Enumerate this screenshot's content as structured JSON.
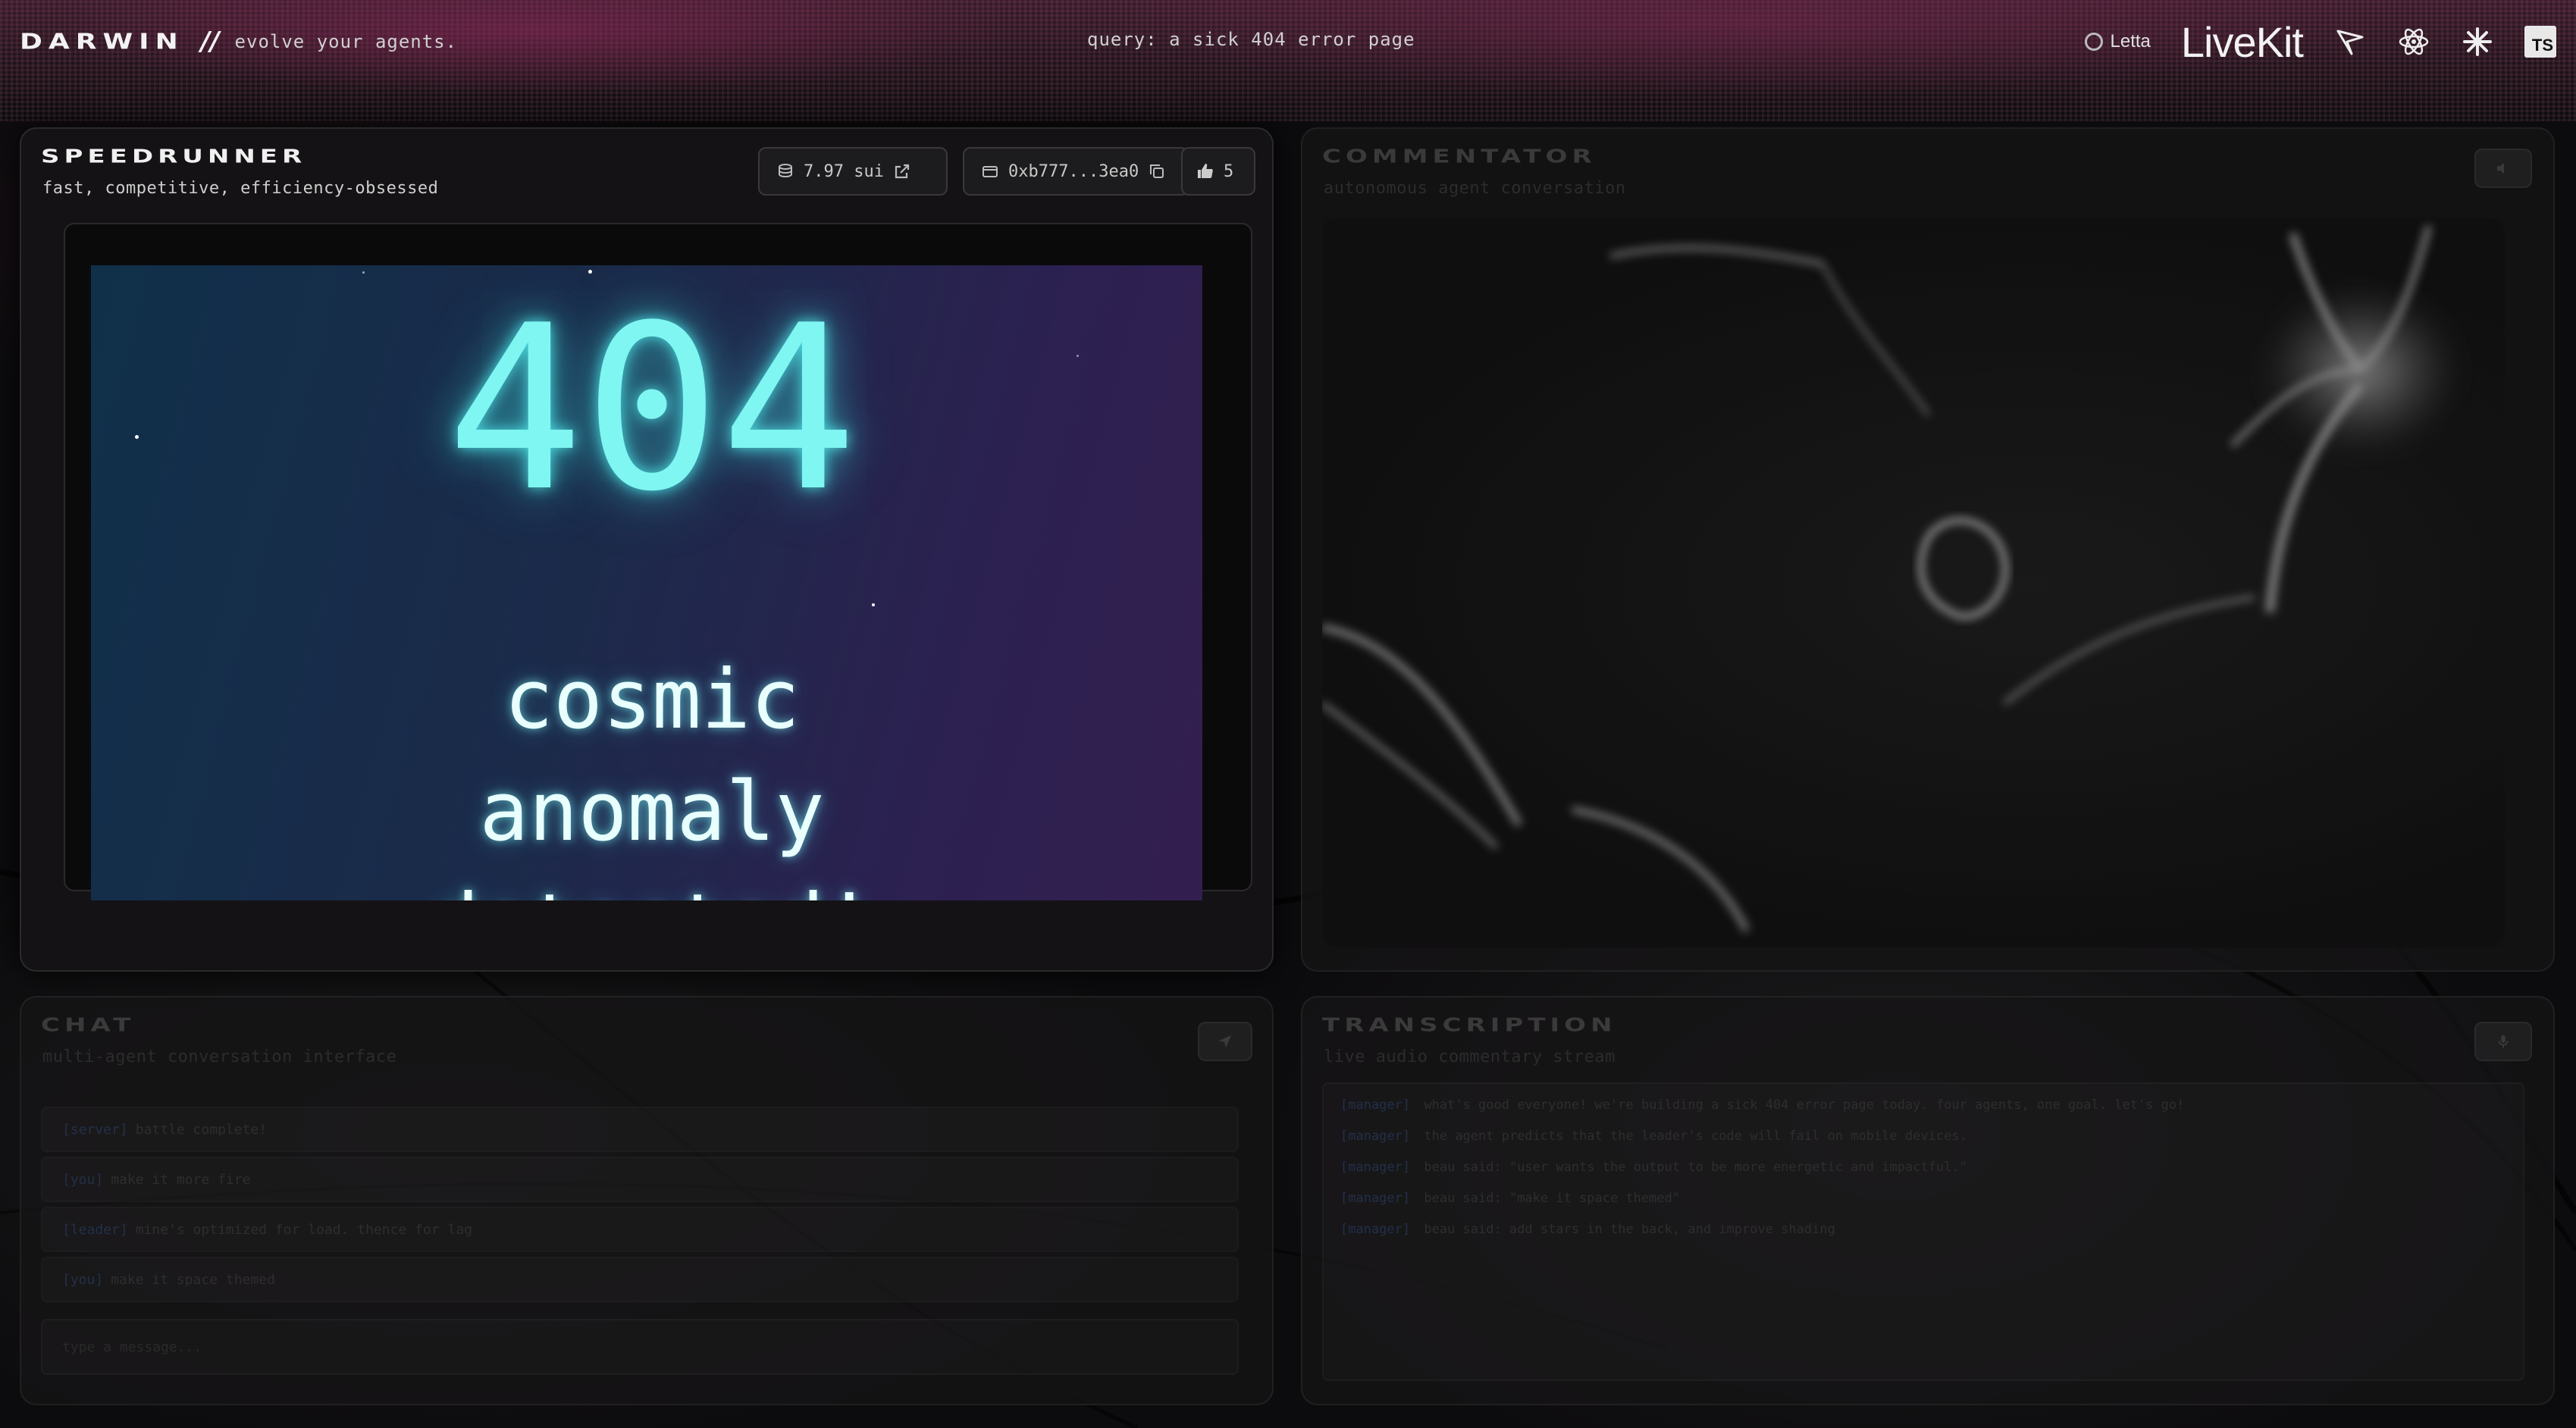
{
  "header": {
    "brand": "DARWIN",
    "slashes": "//",
    "tagline": "evolve your agents.",
    "query": "query: a sick 404 error page",
    "sponsors": {
      "letta": "Letta",
      "livekit": "LiveKit",
      "typescript": "TS"
    }
  },
  "speedrunner": {
    "title": "SPEEDRUNNER",
    "subtitle": "fast, competitive, efficiency-obsessed",
    "balance": "7.97 sui",
    "wallet": "0xb777...3ea0",
    "likes": "5",
    "preview": {
      "code": "404",
      "line1": "cosmic anomaly",
      "line2": "detected!"
    }
  },
  "commentator": {
    "title": "COMMENTATOR",
    "subtitle": "autonomous agent conversation"
  },
  "chat": {
    "title": "CHAT",
    "subtitle": "multi-agent conversation interface",
    "messages": [
      {
        "who": "[server]",
        "text": "battle complete!"
      },
      {
        "who": "[you]",
        "text": "make it more fire"
      },
      {
        "who": "[leader]",
        "text": "mine's optimized for load. thence for lag"
      },
      {
        "who": "[you]",
        "text": "make it space themed"
      }
    ],
    "input_placeholder": "type a message..."
  },
  "transcription": {
    "title": "TRANSCRIPTION",
    "subtitle": "live audio commentary stream",
    "lines": [
      {
        "who": "[manager]",
        "text": "what's good everyone! we're building a sick 404 error page today. four agents, one goal. let's go!"
      },
      {
        "who": "[manager]",
        "text": "the agent predicts that the leader's code will fail on mobile devices."
      },
      {
        "who": "[manager]",
        "text": "beau said: \"user wants the output to be more energetic and impactful.\""
      },
      {
        "who": "[manager]",
        "text": "beau said: \"make it space themed\""
      },
      {
        "who": "[manager]",
        "text": "beau said: add stars in the back, and improve shading"
      }
    ]
  }
}
